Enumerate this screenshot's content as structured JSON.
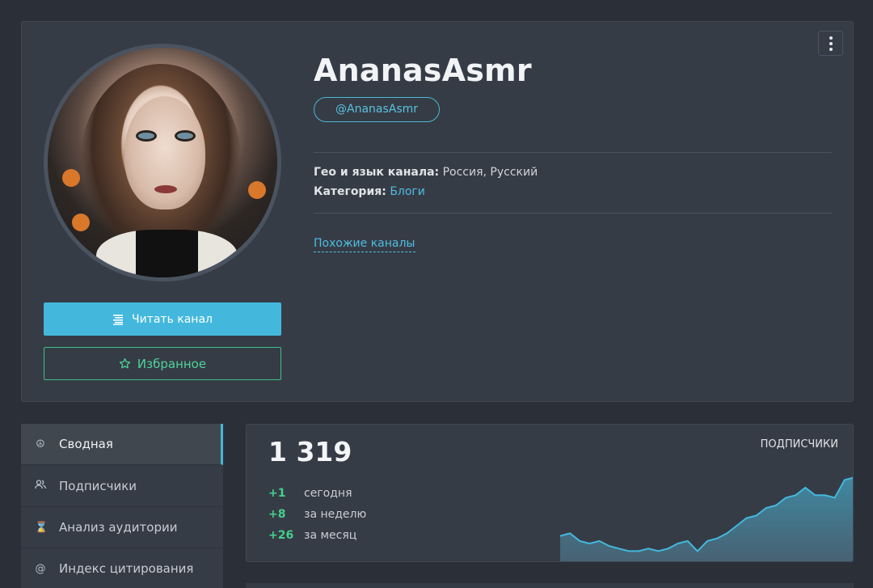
{
  "channel": {
    "title": "AnanasAsmr",
    "handle": "@AnanasAsmr",
    "geo_label": "Гео и язык канала:",
    "geo_value": "Россия, Русский",
    "category_label": "Категория:",
    "category_value": "Блоги",
    "similar_link": "Похожие каналы"
  },
  "buttons": {
    "read": "Читать канал",
    "favorite": "Избранное"
  },
  "icons": {
    "read": "newspaper-icon",
    "favorite": "star-icon",
    "menu": "more-vertical-icon"
  },
  "sidebar": {
    "items": [
      {
        "label": "Сводная",
        "icon": "peace-icon",
        "active": true
      },
      {
        "label": "Подписчики",
        "icon": "users-icon",
        "active": false
      },
      {
        "label": "Анализ аудитории",
        "icon": "hourglass-icon",
        "active": false
      },
      {
        "label": "Индекс цитирования",
        "icon": "at-icon",
        "active": false
      }
    ]
  },
  "stats": {
    "subscribers": "1 319",
    "label": "ПОДПИСЧИКИ",
    "today_delta": "+1",
    "today_label": "сегодня",
    "week_delta": "+8",
    "week_label": "за неделю",
    "month_delta": "+26",
    "month_label": "за месяц"
  },
  "colors": {
    "accent": "#43b8dc",
    "positive": "#44cf8c",
    "card": "#363c46",
    "background": "#2b3038"
  },
  "chart_data": {
    "type": "area",
    "values": [
      1296,
      1297,
      1294,
      1293,
      1294,
      1292,
      1291,
      1290,
      1290,
      1291,
      1290,
      1291,
      1293,
      1294,
      1290,
      1294,
      1295,
      1297,
      1300,
      1303,
      1304,
      1307,
      1308,
      1311,
      1312,
      1315,
      1312,
      1312,
      1311,
      1318,
      1319
    ]
  }
}
